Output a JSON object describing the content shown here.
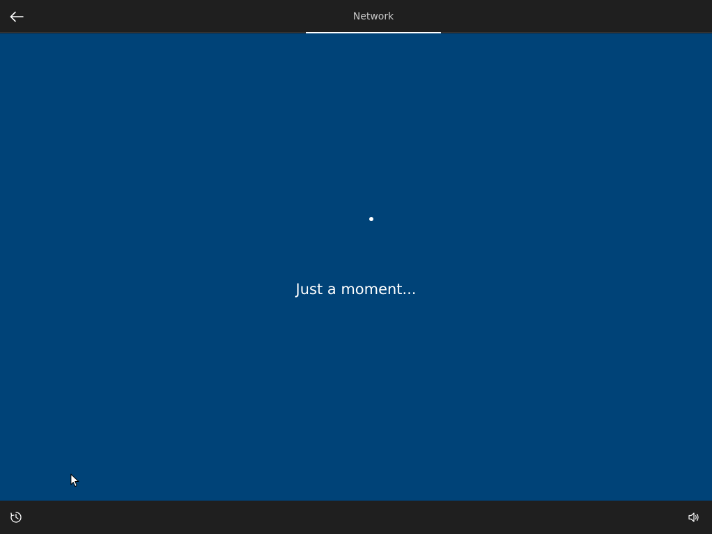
{
  "header": {
    "back_icon": "arrow-left-icon",
    "tab_label": "Network"
  },
  "main": {
    "spinner_icon": "loading-dot-icon",
    "message": "Just a moment..."
  },
  "footer": {
    "accessibility_icon": "ease-of-access-icon",
    "volume_icon": "volume-icon"
  },
  "colors": {
    "background": "#004378",
    "bars": "#1f1f1f",
    "text": "#ffffff",
    "tab_text": "#c8c8c8"
  }
}
